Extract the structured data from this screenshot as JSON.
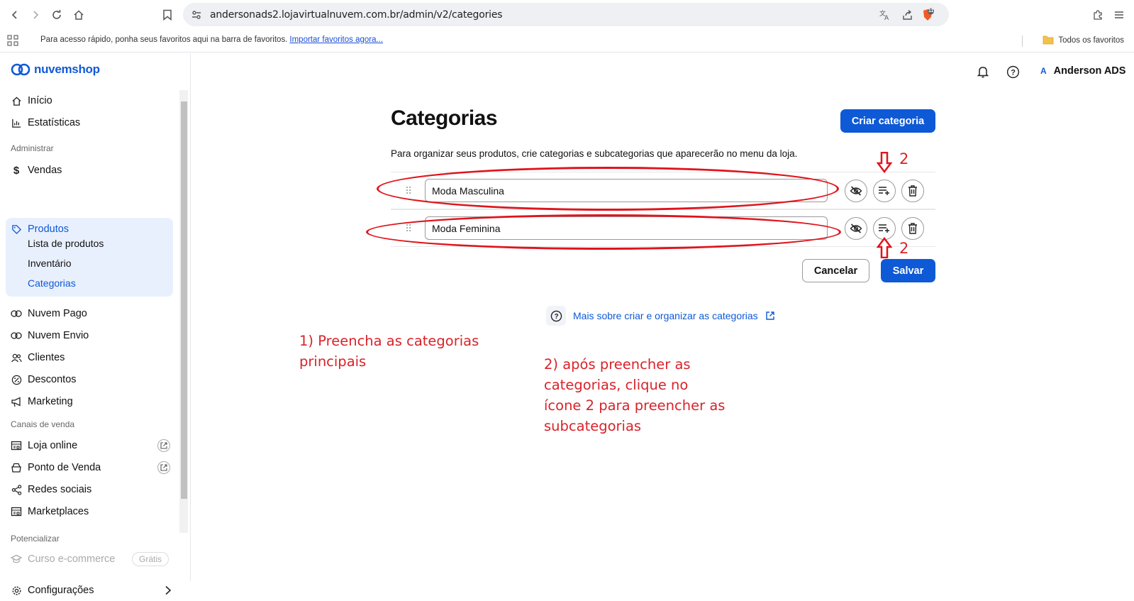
{
  "browser": {
    "url": "andersonads2.lojavirtualnuvem.com.br/admin/v2/categories",
    "bookmark_hint": "Para acesso rápido, ponha seus favoritos aqui na barra de favoritos.",
    "bookmark_import": "Importar favoritos agora...",
    "all_bookmarks": "Todos os favoritos",
    "shield_badge": "11"
  },
  "brand": {
    "name": "nuvemshop"
  },
  "sidebar": {
    "inicio": "Início",
    "estatisticas": "Estatísticas",
    "section_admin": "Administrar",
    "vendas": "Vendas",
    "produtos": "Produtos",
    "lista_produtos": "Lista de produtos",
    "inventario": "Inventário",
    "categorias": "Categorias",
    "nuvem_pago": "Nuvem Pago",
    "nuvem_envio": "Nuvem Envio",
    "clientes": "Clientes",
    "descontos": "Descontos",
    "marketing": "Marketing",
    "section_canais": "Canais de venda",
    "loja_online": "Loja online",
    "ponto_venda": "Ponto de Venda",
    "redes_sociais": "Redes sociais",
    "marketplaces": "Marketplaces",
    "section_potencializar": "Potencializar",
    "curso": "Curso e-commerce",
    "curso_badge": "Grátis",
    "configuracoes": "Configurações"
  },
  "header": {
    "user_initial": "A",
    "user_name": "Anderson ADS"
  },
  "main": {
    "title": "Categorias",
    "create_button": "Criar categoria",
    "description": "Para organizar seus produtos, crie categorias e subcategorias que aparecerão no menu da loja.",
    "categories": [
      {
        "value": "Moda Masculina"
      },
      {
        "value": "Moda Feminina"
      }
    ],
    "cancel_button": "Cancelar",
    "save_button": "Salvar",
    "help_link": "Mais sobre criar e organizar as categorias"
  },
  "annotations": {
    "marker_top": "2",
    "marker_bottom": "2",
    "step1_line1": "1) Preencha as categorias",
    "step1_line2": "principais",
    "step2_line1": "2) após preencher as",
    "step2_line2": "categorias, clique no",
    "step2_line3": "ícone 2 para preencher as",
    "step2_line4": "subcategorias"
  },
  "colors": {
    "accent": "#0e59d6",
    "annotation": "#d8232a"
  }
}
